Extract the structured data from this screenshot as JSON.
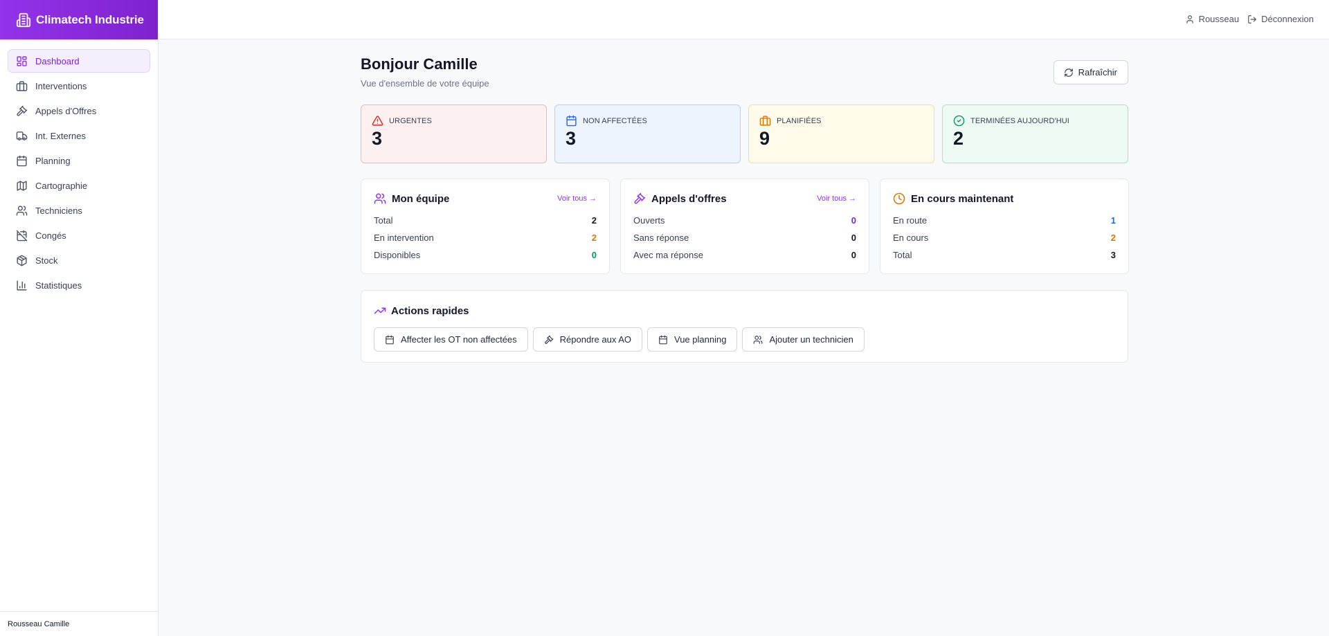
{
  "app": {
    "name": "Climatech Industrie"
  },
  "sidebar": {
    "items": [
      {
        "label": "Dashboard",
        "icon": "dashboard-icon",
        "active": true
      },
      {
        "label": "Interventions",
        "icon": "briefcase-icon"
      },
      {
        "label": "Appels d'Offres",
        "icon": "gavel-icon"
      },
      {
        "label": "Int. Externes",
        "icon": "truck-icon"
      },
      {
        "label": "Planning",
        "icon": "calendar-icon"
      },
      {
        "label": "Cartographie",
        "icon": "map-icon"
      },
      {
        "label": "Techniciens",
        "icon": "users-icon"
      },
      {
        "label": "Congés",
        "icon": "calendar-off-icon"
      },
      {
        "label": "Stock",
        "icon": "package-icon"
      },
      {
        "label": "Statistiques",
        "icon": "bar-chart-icon"
      }
    ],
    "footer_user": "Rousseau Camille"
  },
  "topbar": {
    "user": "Rousseau",
    "logout": "Déconnexion"
  },
  "header": {
    "title": "Bonjour Camille",
    "subtitle": "Vue d'ensemble de votre équipe",
    "refresh_label": "Rafraîchir"
  },
  "stats": [
    {
      "label": "URGENTES",
      "value": "3",
      "icon": "alert-triangle-icon",
      "color": "#dc2626"
    },
    {
      "label": "NON AFFECTÉES",
      "value": "3",
      "icon": "calendar-icon",
      "color": "#2563eb"
    },
    {
      "label": "PLANIFIÉES",
      "value": "9",
      "icon": "briefcase-icon",
      "color": "#d97706"
    },
    {
      "label": "TERMINÉES AUJOURD'HUI",
      "value": "2",
      "icon": "check-circle-icon",
      "color": "#059669"
    }
  ],
  "cards": {
    "team": {
      "title": "Mon équipe",
      "see_all": "Voir tous →",
      "rows": [
        {
          "label": "Total",
          "value": "2",
          "color": "#111827"
        },
        {
          "label": "En intervention",
          "value": "2",
          "color": "#d97706"
        },
        {
          "label": "Disponibles",
          "value": "0",
          "color": "#059669"
        }
      ]
    },
    "tenders": {
      "title": "Appels d'offres",
      "see_all": "Voir tous →",
      "rows": [
        {
          "label": "Ouverts",
          "value": "0",
          "color": "#7e22ce"
        },
        {
          "label": "Sans réponse",
          "value": "0",
          "color": "#111827"
        },
        {
          "label": "Avec ma réponse",
          "value": "0",
          "color": "#111827"
        }
      ]
    },
    "ongoing": {
      "title": "En cours maintenant",
      "rows": [
        {
          "label": "En route",
          "value": "1",
          "color": "#2563eb"
        },
        {
          "label": "En cours",
          "value": "2",
          "color": "#d97706"
        },
        {
          "label": "Total",
          "value": "3",
          "color": "#111827"
        }
      ]
    }
  },
  "quick_actions": {
    "title": "Actions rapides",
    "buttons": [
      {
        "label": "Affecter les OT non affectées",
        "icon": "calendar-icon"
      },
      {
        "label": "Répondre aux AO",
        "icon": "gavel-icon"
      },
      {
        "label": "Vue planning",
        "icon": "calendar-icon"
      },
      {
        "label": "Ajouter un technicien",
        "icon": "users-icon"
      }
    ]
  },
  "colors": {
    "accent": "#9333ea"
  }
}
